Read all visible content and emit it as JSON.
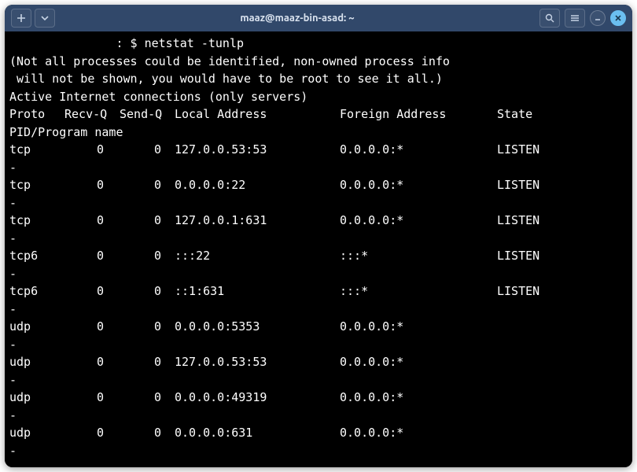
{
  "window": {
    "title": "maaz@maaz-bin-asad: ~"
  },
  "prompt": {
    "prefix": "               : $ ",
    "command": "netstat -tunlp"
  },
  "output": {
    "warning_line1": "(Not all processes could be identified, non-owned process info",
    "warning_line2": " will not be shown, you would have to be root to see it all.)",
    "header_active": "Active Internet connections (only servers)",
    "columns_line1_proto": "Proto",
    "columns_line1_recvq": "Recv-Q",
    "columns_line1_sendq": "Send-Q",
    "columns_line1_local": "Local Address",
    "columns_line1_foreign": "Foreign Address",
    "columns_line1_state": "State",
    "columns_line2": "PID/Program name",
    "rows": [
      {
        "proto": "tcp",
        "recvq": "0",
        "sendq": "0",
        "local": "127.0.0.53:53",
        "foreign": "0.0.0.0:*",
        "state": "LISTEN",
        "pid": "-"
      },
      {
        "proto": "tcp",
        "recvq": "0",
        "sendq": "0",
        "local": "0.0.0.0:22",
        "foreign": "0.0.0.0:*",
        "state": "LISTEN",
        "pid": "-"
      },
      {
        "proto": "tcp",
        "recvq": "0",
        "sendq": "0",
        "local": "127.0.0.1:631",
        "foreign": "0.0.0.0:*",
        "state": "LISTEN",
        "pid": "-"
      },
      {
        "proto": "tcp6",
        "recvq": "0",
        "sendq": "0",
        "local": ":::22",
        "foreign": ":::*",
        "state": "LISTEN",
        "pid": "-"
      },
      {
        "proto": "tcp6",
        "recvq": "0",
        "sendq": "0",
        "local": "::1:631",
        "foreign": ":::*",
        "state": "LISTEN",
        "pid": "-"
      },
      {
        "proto": "udp",
        "recvq": "0",
        "sendq": "0",
        "local": "0.0.0.0:5353",
        "foreign": "0.0.0.0:*",
        "state": "",
        "pid": "-"
      },
      {
        "proto": "udp",
        "recvq": "0",
        "sendq": "0",
        "local": "127.0.0.53:53",
        "foreign": "0.0.0.0:*",
        "state": "",
        "pid": "-"
      },
      {
        "proto": "udp",
        "recvq": "0",
        "sendq": "0",
        "local": "0.0.0.0:49319",
        "foreign": "0.0.0.0:*",
        "state": "",
        "pid": "-"
      },
      {
        "proto": "udp",
        "recvq": "0",
        "sendq": "0",
        "local": "0.0.0.0:631",
        "foreign": "0.0.0.0:*",
        "state": "",
        "pid": "-"
      }
    ]
  }
}
